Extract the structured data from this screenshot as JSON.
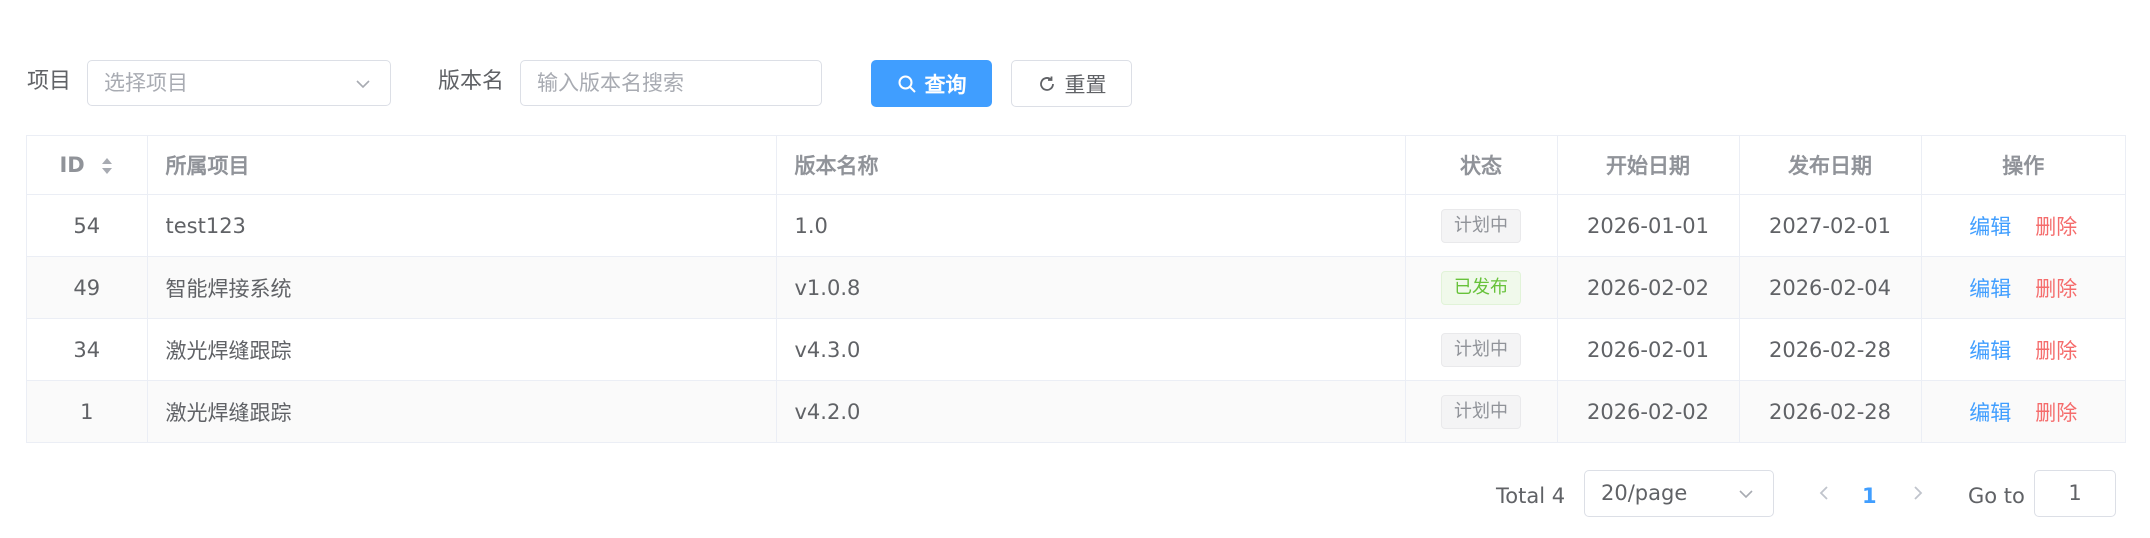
{
  "filters": {
    "project_label": "项目",
    "project_placeholder": "选择项目",
    "version_label": "版本名",
    "version_placeholder": "输入版本名搜索",
    "search_label": "查询",
    "reset_label": "重置"
  },
  "table": {
    "columns": [
      "ID",
      "所属项目",
      "版本名称",
      "状态",
      "开始日期",
      "发布日期",
      "操作"
    ],
    "rows": [
      {
        "id": "54",
        "project": "test123",
        "version": "1.0",
        "status": "计划中",
        "status_type": "info",
        "start": "2026-01-01",
        "release": "2027-02-01",
        "edit": "编辑",
        "delete": "删除"
      },
      {
        "id": "49",
        "project": "智能焊接系统",
        "version": "v1.0.8",
        "status": "已发布",
        "status_type": "success",
        "start": "2026-02-02",
        "release": "2026-02-04",
        "edit": "编辑",
        "delete": "删除"
      },
      {
        "id": "34",
        "project": "激光焊缝跟踪",
        "version": "v4.3.0",
        "status": "计划中",
        "status_type": "info",
        "start": "2026-02-01",
        "release": "2026-02-28",
        "edit": "编辑",
        "delete": "删除"
      },
      {
        "id": "1",
        "project": "激光焊缝跟踪",
        "version": "v4.2.0",
        "status": "计划中",
        "status_type": "info",
        "start": "2026-02-02",
        "release": "2026-02-28",
        "edit": "编辑",
        "delete": "删除"
      }
    ]
  },
  "pagination": {
    "total": "Total 4",
    "page_size": "20/page",
    "current_page": "1",
    "goto_label": "Go to",
    "goto_value": "1"
  },
  "icons": {
    "search": "search-icon",
    "reset": "refresh-icon",
    "chevron": "chevron-down-icon",
    "sort": "sort-caret-icon",
    "prev": "chevron-left-icon",
    "next": "chevron-right-icon"
  },
  "colors": {
    "primary": "#409eff",
    "danger": "#f56c6c",
    "success": "#67c23a",
    "info": "#909399"
  }
}
